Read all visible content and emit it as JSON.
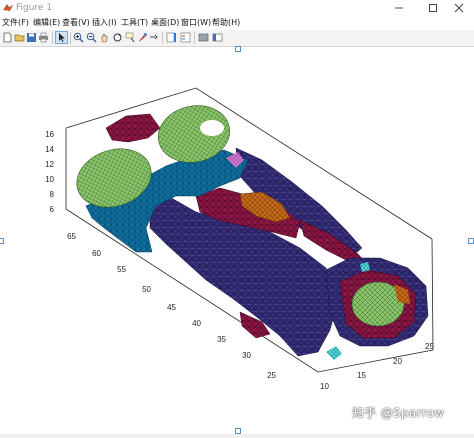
{
  "window": {
    "title": "Figure 1"
  },
  "menu": [
    "文件(F)",
    "编辑(E)",
    "查看(V)",
    "插入(I)",
    "工具(T)",
    "桌面(D)",
    "窗口(W)",
    "帮助(H)"
  ],
  "toolbar": {
    "icons": [
      "new-icon",
      "open-icon",
      "save-icon",
      "print-icon",
      "pointer-icon",
      "zoom-in-icon",
      "zoom-out-icon",
      "pan-icon",
      "rotate-icon",
      "data-cursor-icon",
      "brush-icon",
      "link-icon",
      "insert-colorbar-icon",
      "insert-legend-icon",
      "hide-plot-tools-icon",
      "show-plot-tools-icon"
    ],
    "active": "pointer-icon"
  },
  "axes": {
    "z_ticks": [
      "6",
      "8",
      "10",
      "12",
      "14",
      "16"
    ],
    "y_ticks": [
      "25",
      "30",
      "35",
      "40",
      "45",
      "50",
      "55",
      "60",
      "65"
    ],
    "x_ticks": [
      "10",
      "15",
      "20",
      "25"
    ]
  },
  "watermark": "知乎 @Sparrow",
  "colors": {
    "surface_dark": "#2a2266",
    "surface_teal": "#0e6f9e",
    "surface_maroon": "#8c1644",
    "surface_green": "#8ac46a",
    "surface_orange": "#c26a18"
  }
}
